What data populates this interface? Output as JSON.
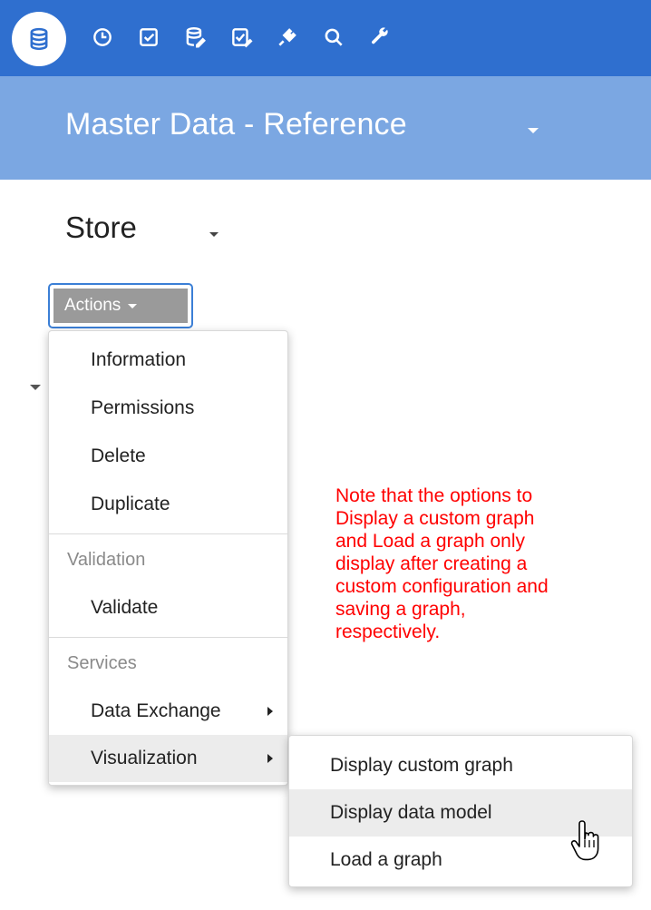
{
  "toolbar": {
    "icons": [
      "database-icon",
      "history-icon",
      "checkbox-icon",
      "database-edit-icon",
      "checklist-icon",
      "plug-icon",
      "search-icon",
      "wrench-icon"
    ],
    "active": "database-icon",
    "color": "#2f6fcf"
  },
  "header": {
    "title": "Master Data - Reference",
    "color": "#7ba7e2"
  },
  "page": {
    "title": "Store"
  },
  "actions": {
    "label": "Actions"
  },
  "menu": {
    "items": [
      "Information",
      "Permissions",
      "Delete",
      "Duplicate"
    ],
    "validation_header": "Validation",
    "validate": "Validate",
    "services_header": "Services",
    "data_exchange": "Data Exchange",
    "visualization": "Visualization"
  },
  "submenu": {
    "items": [
      "Display custom graph",
      "Display data model",
      "Load a graph"
    ],
    "highlighted": "Display data model"
  },
  "note": {
    "lines": [
      "Note that the options to",
      "Display a custom graph",
      "and Load a graph only",
      "display after creating a",
      "custom configuration and",
      "saving a graph,",
      "respectively."
    ],
    "color": "#ff0000"
  }
}
